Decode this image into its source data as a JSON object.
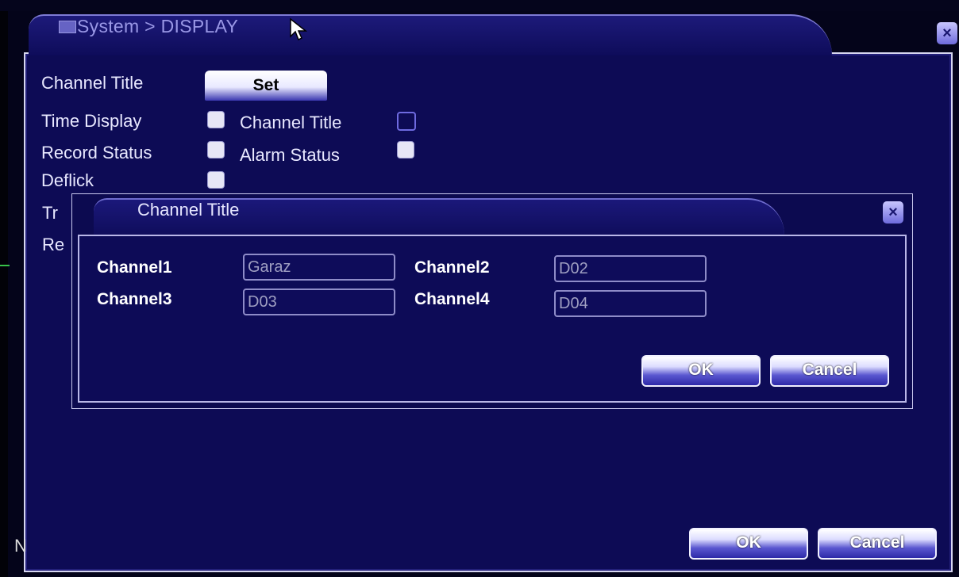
{
  "window": {
    "breadcrumb": "System > DISPLAY",
    "close_label": "×"
  },
  "settings": {
    "channel_title_label": "Channel Title",
    "set_button_label": "Set",
    "time_display_label": "Time Display",
    "time_display_checked": true,
    "channel_title_toggle_label": "Channel Title",
    "channel_title_toggle_checked": false,
    "record_status_label": "Record Status",
    "record_status_checked": true,
    "alarm_status_label": "Alarm Status",
    "alarm_status_checked": true,
    "deflick_label": "Deflick",
    "deflick_checked": true,
    "partial_label_1": "Tr",
    "partial_label_2": "Re"
  },
  "footer": {
    "ok_label": "OK",
    "cancel_label": "Cancel",
    "corner_char": "N"
  },
  "dialog": {
    "title": "Channel Title",
    "close_label": "×",
    "channels": [
      {
        "label": "Channel1",
        "value": "Garaz"
      },
      {
        "label": "Channel2",
        "value": "D02"
      },
      {
        "label": "Channel3",
        "value": "D03"
      },
      {
        "label": "Channel4",
        "value": "D04"
      }
    ],
    "ok_label": "OK",
    "cancel_label": "Cancel"
  }
}
